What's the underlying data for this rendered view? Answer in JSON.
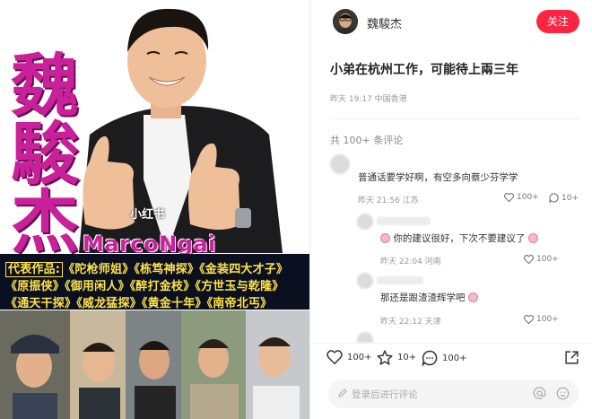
{
  "poster": {
    "title_chars": [
      "魏",
      "駿",
      "杰"
    ],
    "name_en": "MarcoNgai",
    "watermark": "小红书",
    "works_label": "代表作品:",
    "works_rows": [
      "《陀枪师姐》《栋笃神探》《金装四大才子》",
      "《原振侠》《御用闲人》《醉打金枝》《方世玉与乾隆》",
      "《通天干探》《威龙猛探》《黄金十年》《南帝北丐》"
    ],
    "colors": {
      "title": "#c8219a",
      "works_text": "#ffe24a",
      "band": "#0b1020"
    }
  },
  "author": {
    "name": "魏駿杰",
    "follow_label": "关注",
    "avatar_icon": "avatar-photo"
  },
  "post": {
    "title": "小弟在杭州工作，可能待上兩三年",
    "meta": "昨天 19:17 中国香港",
    "comment_count": "共 100+ 条评论"
  },
  "comments": [
    {
      "text": "普通话要学好啊，有空多向蔡少芬学学",
      "meta": "昨天 21:56 江苏",
      "likes": "100+",
      "replies": "10+"
    },
    {
      "text": "你的建议很好，下次不要建议了",
      "meta": "昨天 22:04 河南",
      "likes": "100+"
    },
    {
      "text": "那还是跟渣渣辉学吧",
      "meta": "昨天 22:12 天津",
      "likes": "100+"
    }
  ],
  "actions": {
    "like_count": "100+",
    "star_count": "10+",
    "comment_count": "100+",
    "icons": [
      "heart-icon",
      "star-icon",
      "comment-icon",
      "share-icon"
    ]
  },
  "comment_input": {
    "placeholder": "登录后进行评论",
    "icons": [
      "pencil-icon",
      "at-icon",
      "smile-icon"
    ]
  },
  "colors": {
    "accent": "#ff2442",
    "meta": "#999999"
  }
}
